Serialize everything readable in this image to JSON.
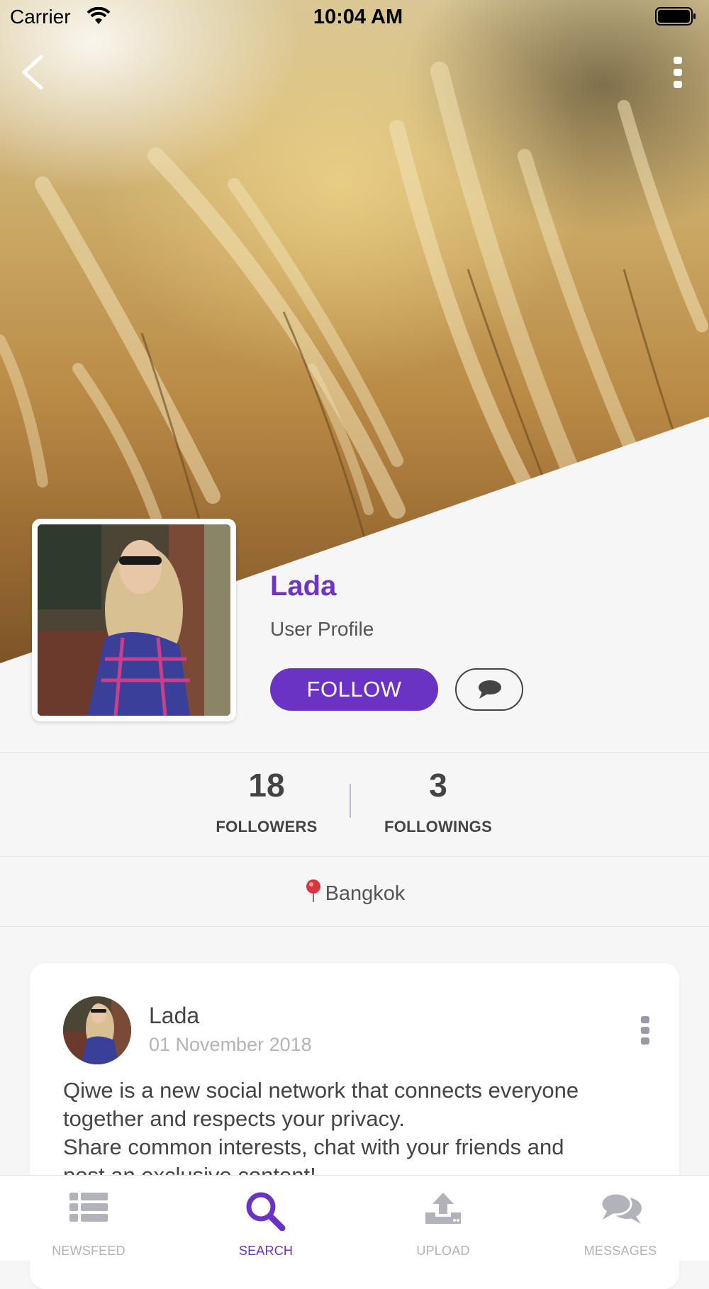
{
  "status_bar": {
    "carrier": "Carrier",
    "time": "10:04 AM"
  },
  "nav": {
    "back_icon": "chevron-left-icon",
    "more_icon": "more-vertical-icon"
  },
  "profile": {
    "name": "Lada",
    "subtitle": "User Profile",
    "follow_label": "FOLLOW",
    "chat_icon": "chat-bubble-icon",
    "accent_color": "#6b33c4"
  },
  "stats": {
    "followers_count": "18",
    "followers_label": "FOLLOWERS",
    "followings_count": "3",
    "followings_label": "FOLLOWINGS"
  },
  "location": {
    "icon": "map-pin-icon",
    "text": "Bangkok"
  },
  "post": {
    "author": "Lada",
    "date": "01 November 2018",
    "text_line1": "Qiwe is a new social network that connects everyone",
    "text_line2": "together and respects your privacy.",
    "text_line3": "Share common interests, chat with your friends and",
    "text_line4": "post an exclusive content!"
  },
  "tabbar": {
    "tabs": [
      {
        "label": "NEWSFEED",
        "icon": "list-icon",
        "active": false
      },
      {
        "label": "SEARCH",
        "icon": "search-icon",
        "active": true
      },
      {
        "label": "UPLOAD",
        "icon": "upload-icon",
        "active": false
      },
      {
        "label": "MESSAGES",
        "icon": "messages-icon",
        "active": false
      }
    ]
  }
}
